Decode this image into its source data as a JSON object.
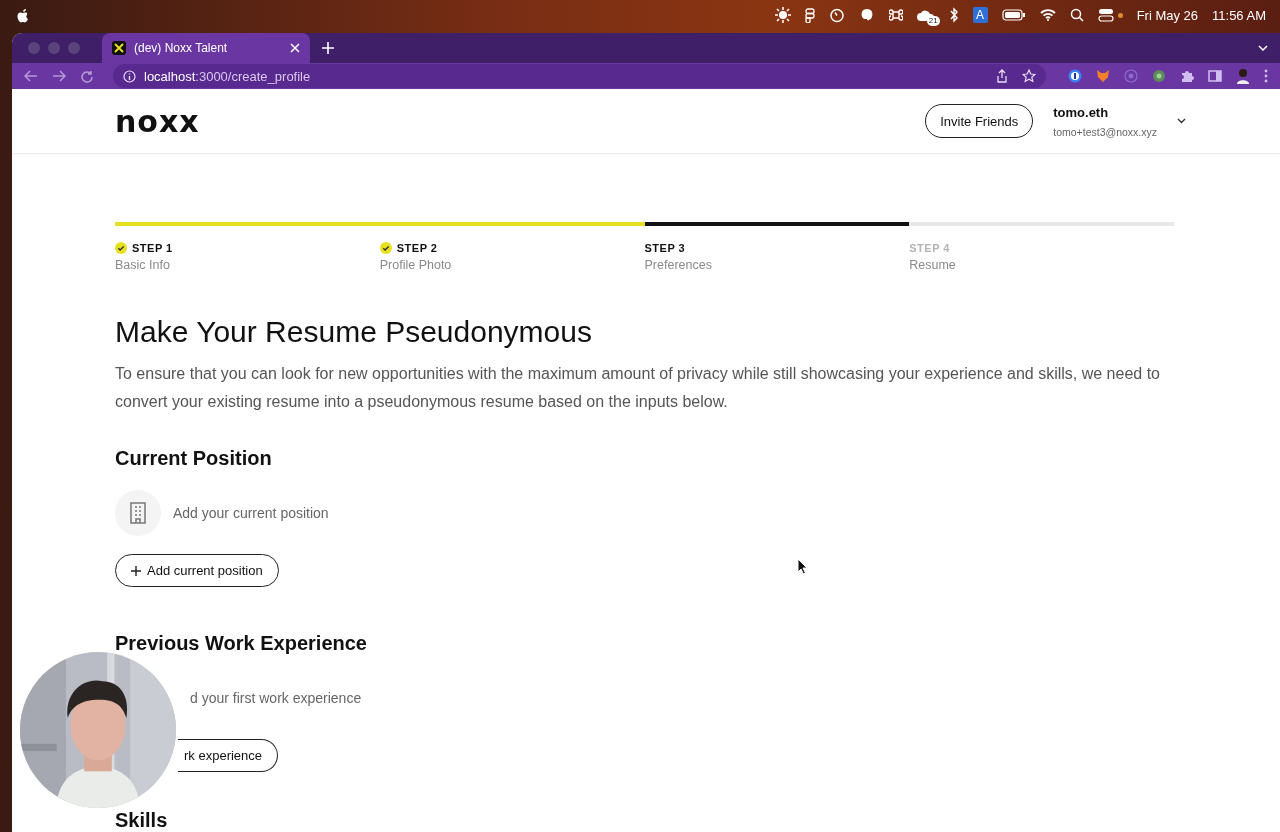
{
  "menubar": {
    "badge": "21",
    "input_source": "A",
    "date": "Fri May 26",
    "time": "11:56 AM"
  },
  "browser": {
    "tab_title": "(dev) Noxx Talent",
    "url_host": "localhost",
    "url_path": ":3000/create_profile"
  },
  "header": {
    "logo": "noxx",
    "invite_button": "Invite Friends",
    "user_name": "tomo.eth",
    "user_email": "tomo+test3@noxx.xyz"
  },
  "steps": [
    {
      "label": "STEP 1",
      "title": "Basic Info",
      "completed": true,
      "selected": false
    },
    {
      "label": "STEP 2",
      "title": "Profile Photo",
      "completed": true,
      "selected": false
    },
    {
      "label": "STEP 3",
      "title": "Preferences",
      "completed": false,
      "selected": true
    },
    {
      "label": "STEP 4",
      "title": "Resume",
      "completed": false,
      "selected": false
    }
  ],
  "title": "Make Your Resume Pseudonymous",
  "intro": "To ensure that you can look for new opportunities with the maximum amount of privacy while still showcasing your experience and skills, we need to convert your existing resume into a pseudonymous resume based on the inputs below.",
  "sections": [
    {
      "heading": "Current Position",
      "empty_text": "Add your current position",
      "button": "Add current position",
      "covered": false
    },
    {
      "heading": "Previous Work Experience",
      "empty_text": "d your first work experience",
      "button": "rk experience",
      "covered": true
    },
    {
      "heading": "Skills"
    }
  ]
}
